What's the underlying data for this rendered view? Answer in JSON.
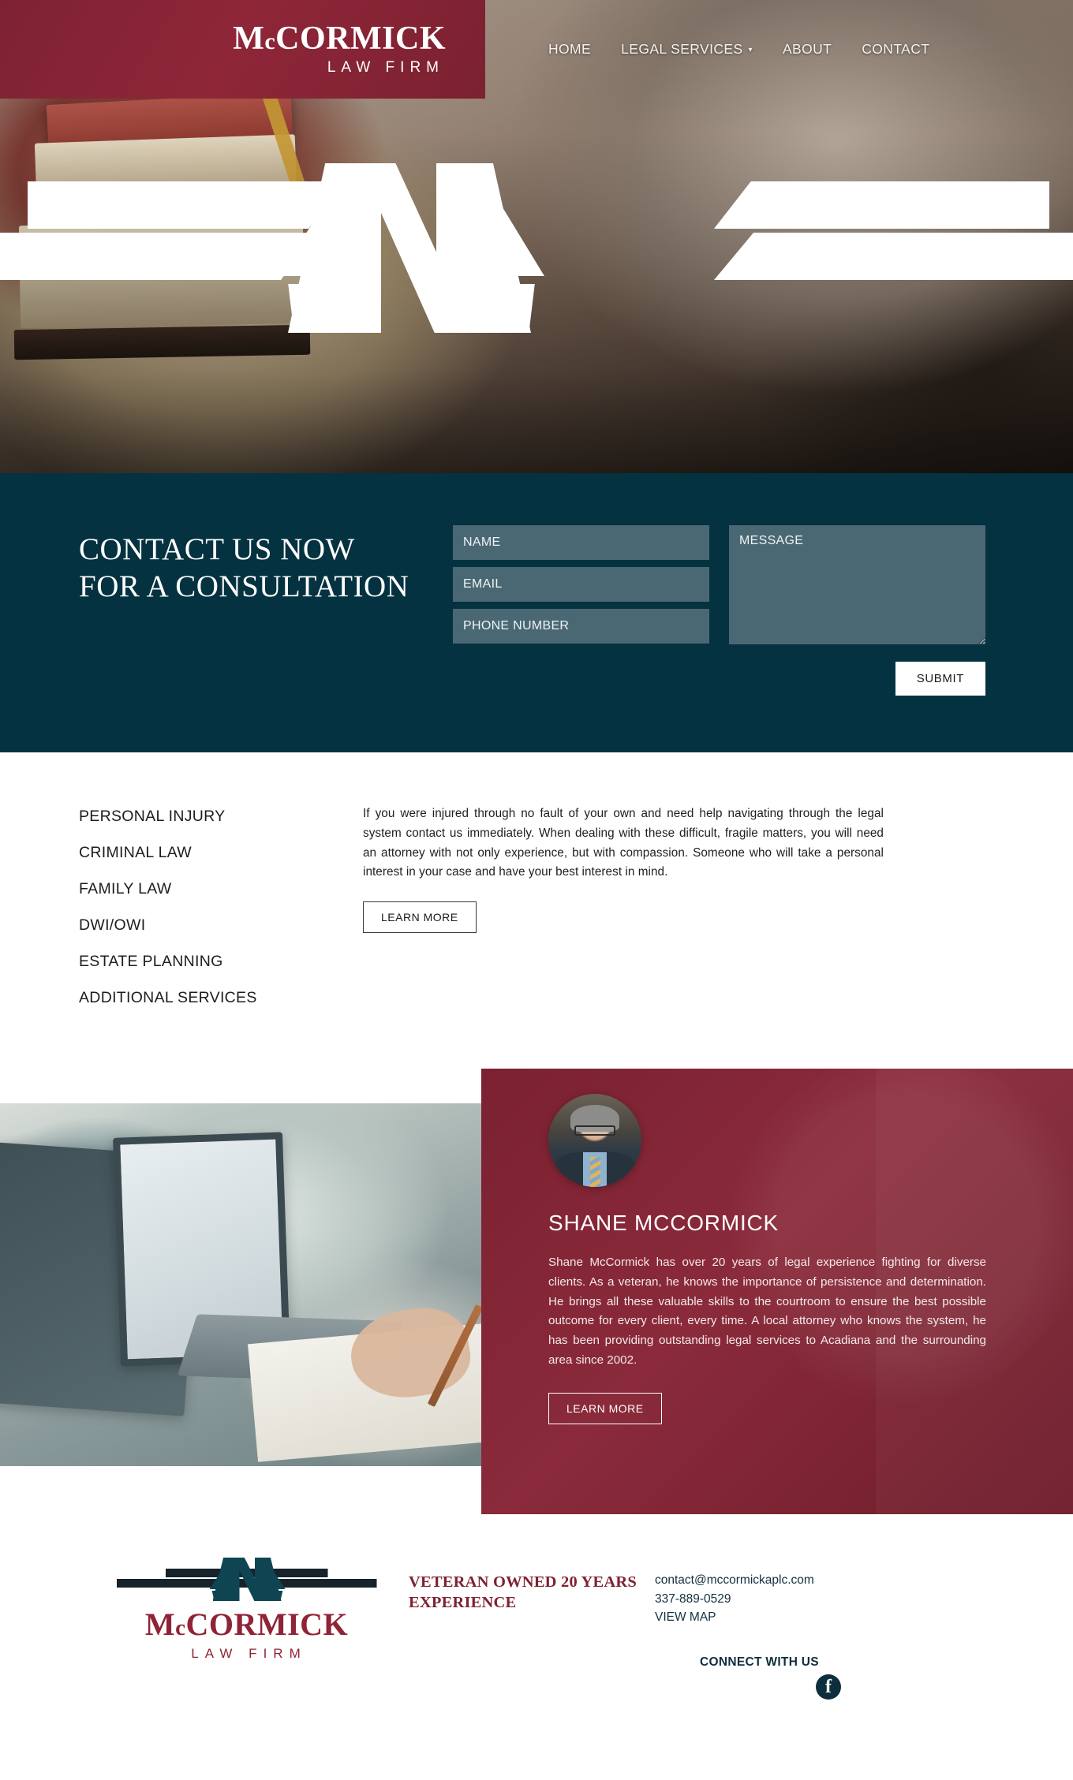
{
  "brand": {
    "name_prefix": "M",
    "name_small": "c",
    "name_rest": "CORMICK",
    "full_name": "McCORMICK",
    "subtitle": "LAW FIRM",
    "accent_red": "#8e2638",
    "accent_teal": "#043240"
  },
  "nav": {
    "items": [
      {
        "label": "HOME",
        "has_dropdown": false
      },
      {
        "label": "LEGAL SERVICES",
        "has_dropdown": true,
        "caret": "▾"
      },
      {
        "label": "ABOUT",
        "has_dropdown": false
      },
      {
        "label": "CONTACT",
        "has_dropdown": false
      }
    ]
  },
  "contact_section": {
    "title": "CONTACT US NOW FOR A CONSULTATION",
    "fields": {
      "name_placeholder": "NAME",
      "email_placeholder": "EMAIL",
      "phone_placeholder": "PHONE NUMBER",
      "message_placeholder": "MESSAGE"
    },
    "submit_label": "SUBMIT"
  },
  "services_section": {
    "items": [
      "PERSONAL INJURY",
      "CRIMINAL LAW",
      "FAMILY LAW",
      "DWI/OWI",
      "ESTATE PLANNING",
      "ADDITIONAL SERVICES"
    ],
    "paragraph": "If you were injured through no fault of your own and need help navigating through the legal system contact us immediately. When dealing with these difficult, fragile matters, you will need an attorney with not only experience, but with compassion. Someone who will take a personal interest in your case and have your best interest in mind.",
    "learn_more_label": "LEARN MORE"
  },
  "attorney_section": {
    "name": "SHANE MCCORMICK",
    "bio": "Shane McCormick has over 20 years of legal experience fighting for diverse clients. As a veteran, he knows the importance of persistence and determination. He brings all these valuable skills to the courtroom to ensure the best possible outcome for every client, every time. A local attorney who knows the system, he has been providing outstanding legal services to Acadiana and the surrounding area since 2002.",
    "learn_more_label": "LEARN MORE"
  },
  "footer": {
    "tagline": "VETERAN OWNED 20 YEARS EXPERIENCE",
    "email": "contact@mccormickaplc.com",
    "phone": "337-889-0529",
    "map_label": "VIEW MAP",
    "connect_label": "CONNECT WITH US",
    "facebook_glyph": "f"
  }
}
